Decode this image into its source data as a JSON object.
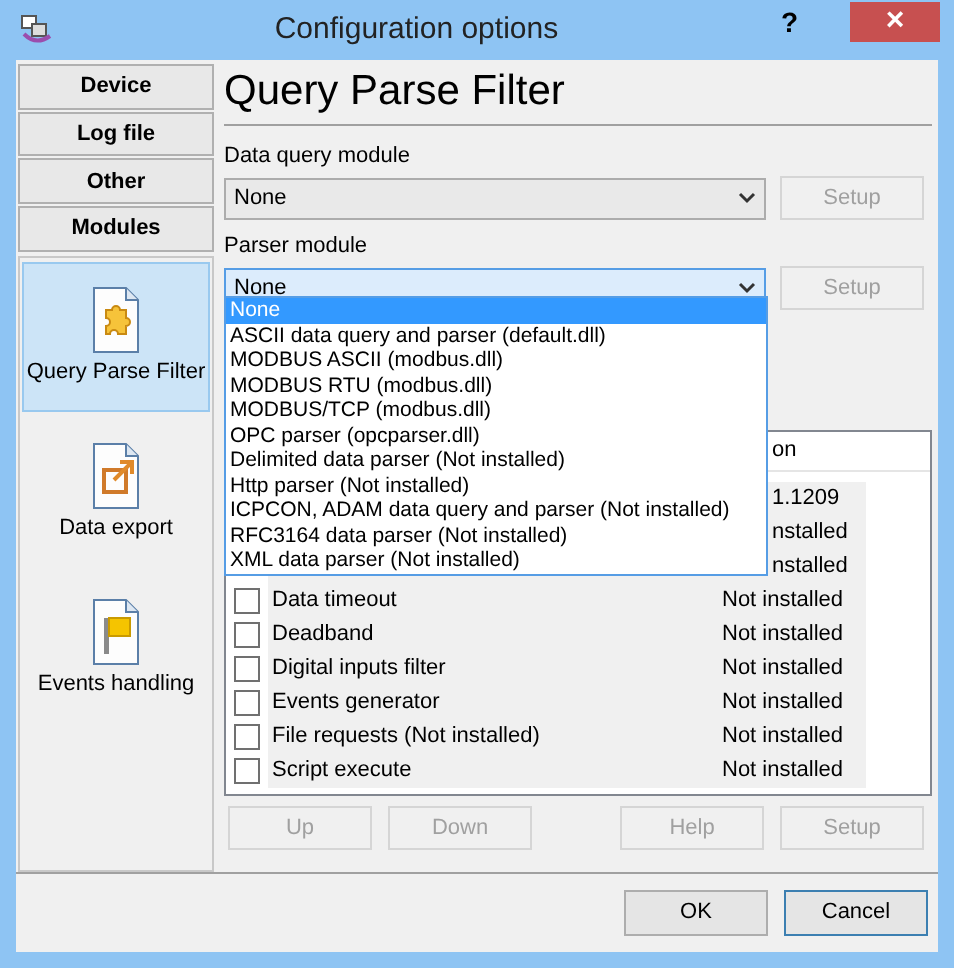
{
  "window": {
    "title": "Configuration options",
    "help": "?",
    "close": "×"
  },
  "nav_buttons": [
    {
      "label": "Device"
    },
    {
      "label": "Log file"
    },
    {
      "label": "Other"
    },
    {
      "label": "Modules"
    }
  ],
  "modules": [
    {
      "label": "Query Parse Filter",
      "kind": "puzzle",
      "selected": true
    },
    {
      "label": "Data export",
      "kind": "export",
      "selected": false
    },
    {
      "label": "Events handling",
      "kind": "flag",
      "selected": false
    }
  ],
  "page_title": "Query Parse Filter",
  "data_query": {
    "label": "Data query module",
    "value": "None",
    "setup": "Setup"
  },
  "parser": {
    "label": "Parser module",
    "value": "None",
    "setup": "Setup",
    "expanded": true,
    "options": [
      {
        "label": "None",
        "selected": true
      },
      {
        "label": "ASCII data query and parser (default.dll)",
        "selected": false
      },
      {
        "label": "MODBUS ASCII (modbus.dll)",
        "selected": false
      },
      {
        "label": "MODBUS RTU (modbus.dll)",
        "selected": false
      },
      {
        "label": "MODBUS/TCP (modbus.dll)",
        "selected": false
      },
      {
        "label": "OPC parser (opcparser.dll)",
        "selected": false
      },
      {
        "label": "Delimited data parser (Not installed)",
        "selected": false
      },
      {
        "label": "Http parser (Not installed)",
        "selected": false
      },
      {
        "label": "ICPCON, ADAM data query and parser (Not installed)",
        "selected": false
      },
      {
        "label": "RFC3164 data parser (Not installed)",
        "selected": false
      },
      {
        "label": "XML data parser (Not installed)",
        "selected": false
      }
    ]
  },
  "filters": {
    "column_2": "on",
    "rows": [
      {
        "kind": "partial",
        "status": "1.1209"
      },
      {
        "kind": "partial",
        "status": "nstalled"
      },
      {
        "kind": "partial",
        "status": "nstalled"
      },
      {
        "kind": "full",
        "name": "Data timeout",
        "status": "Not installed",
        "checked": false
      },
      {
        "kind": "full",
        "name": "Deadband",
        "status": "Not installed",
        "checked": false
      },
      {
        "kind": "full",
        "name": "Digital inputs filter",
        "status": "Not installed",
        "checked": false
      },
      {
        "kind": "full",
        "name": "Events generator",
        "status": "Not installed",
        "checked": false
      },
      {
        "kind": "full",
        "name": "File requests (Not installed)",
        "status": "Not installed",
        "checked": false
      },
      {
        "kind": "full",
        "name": "Script execute",
        "status": "Not installed",
        "checked": false
      }
    ]
  },
  "list_buttons": [
    {
      "label": "Up",
      "disabled": true
    },
    {
      "label": "Down",
      "disabled": true
    },
    {
      "label": "Help",
      "disabled": true
    },
    {
      "label": "Setup",
      "disabled": true
    }
  ],
  "ok": "OK",
  "cancel": "Cancel"
}
